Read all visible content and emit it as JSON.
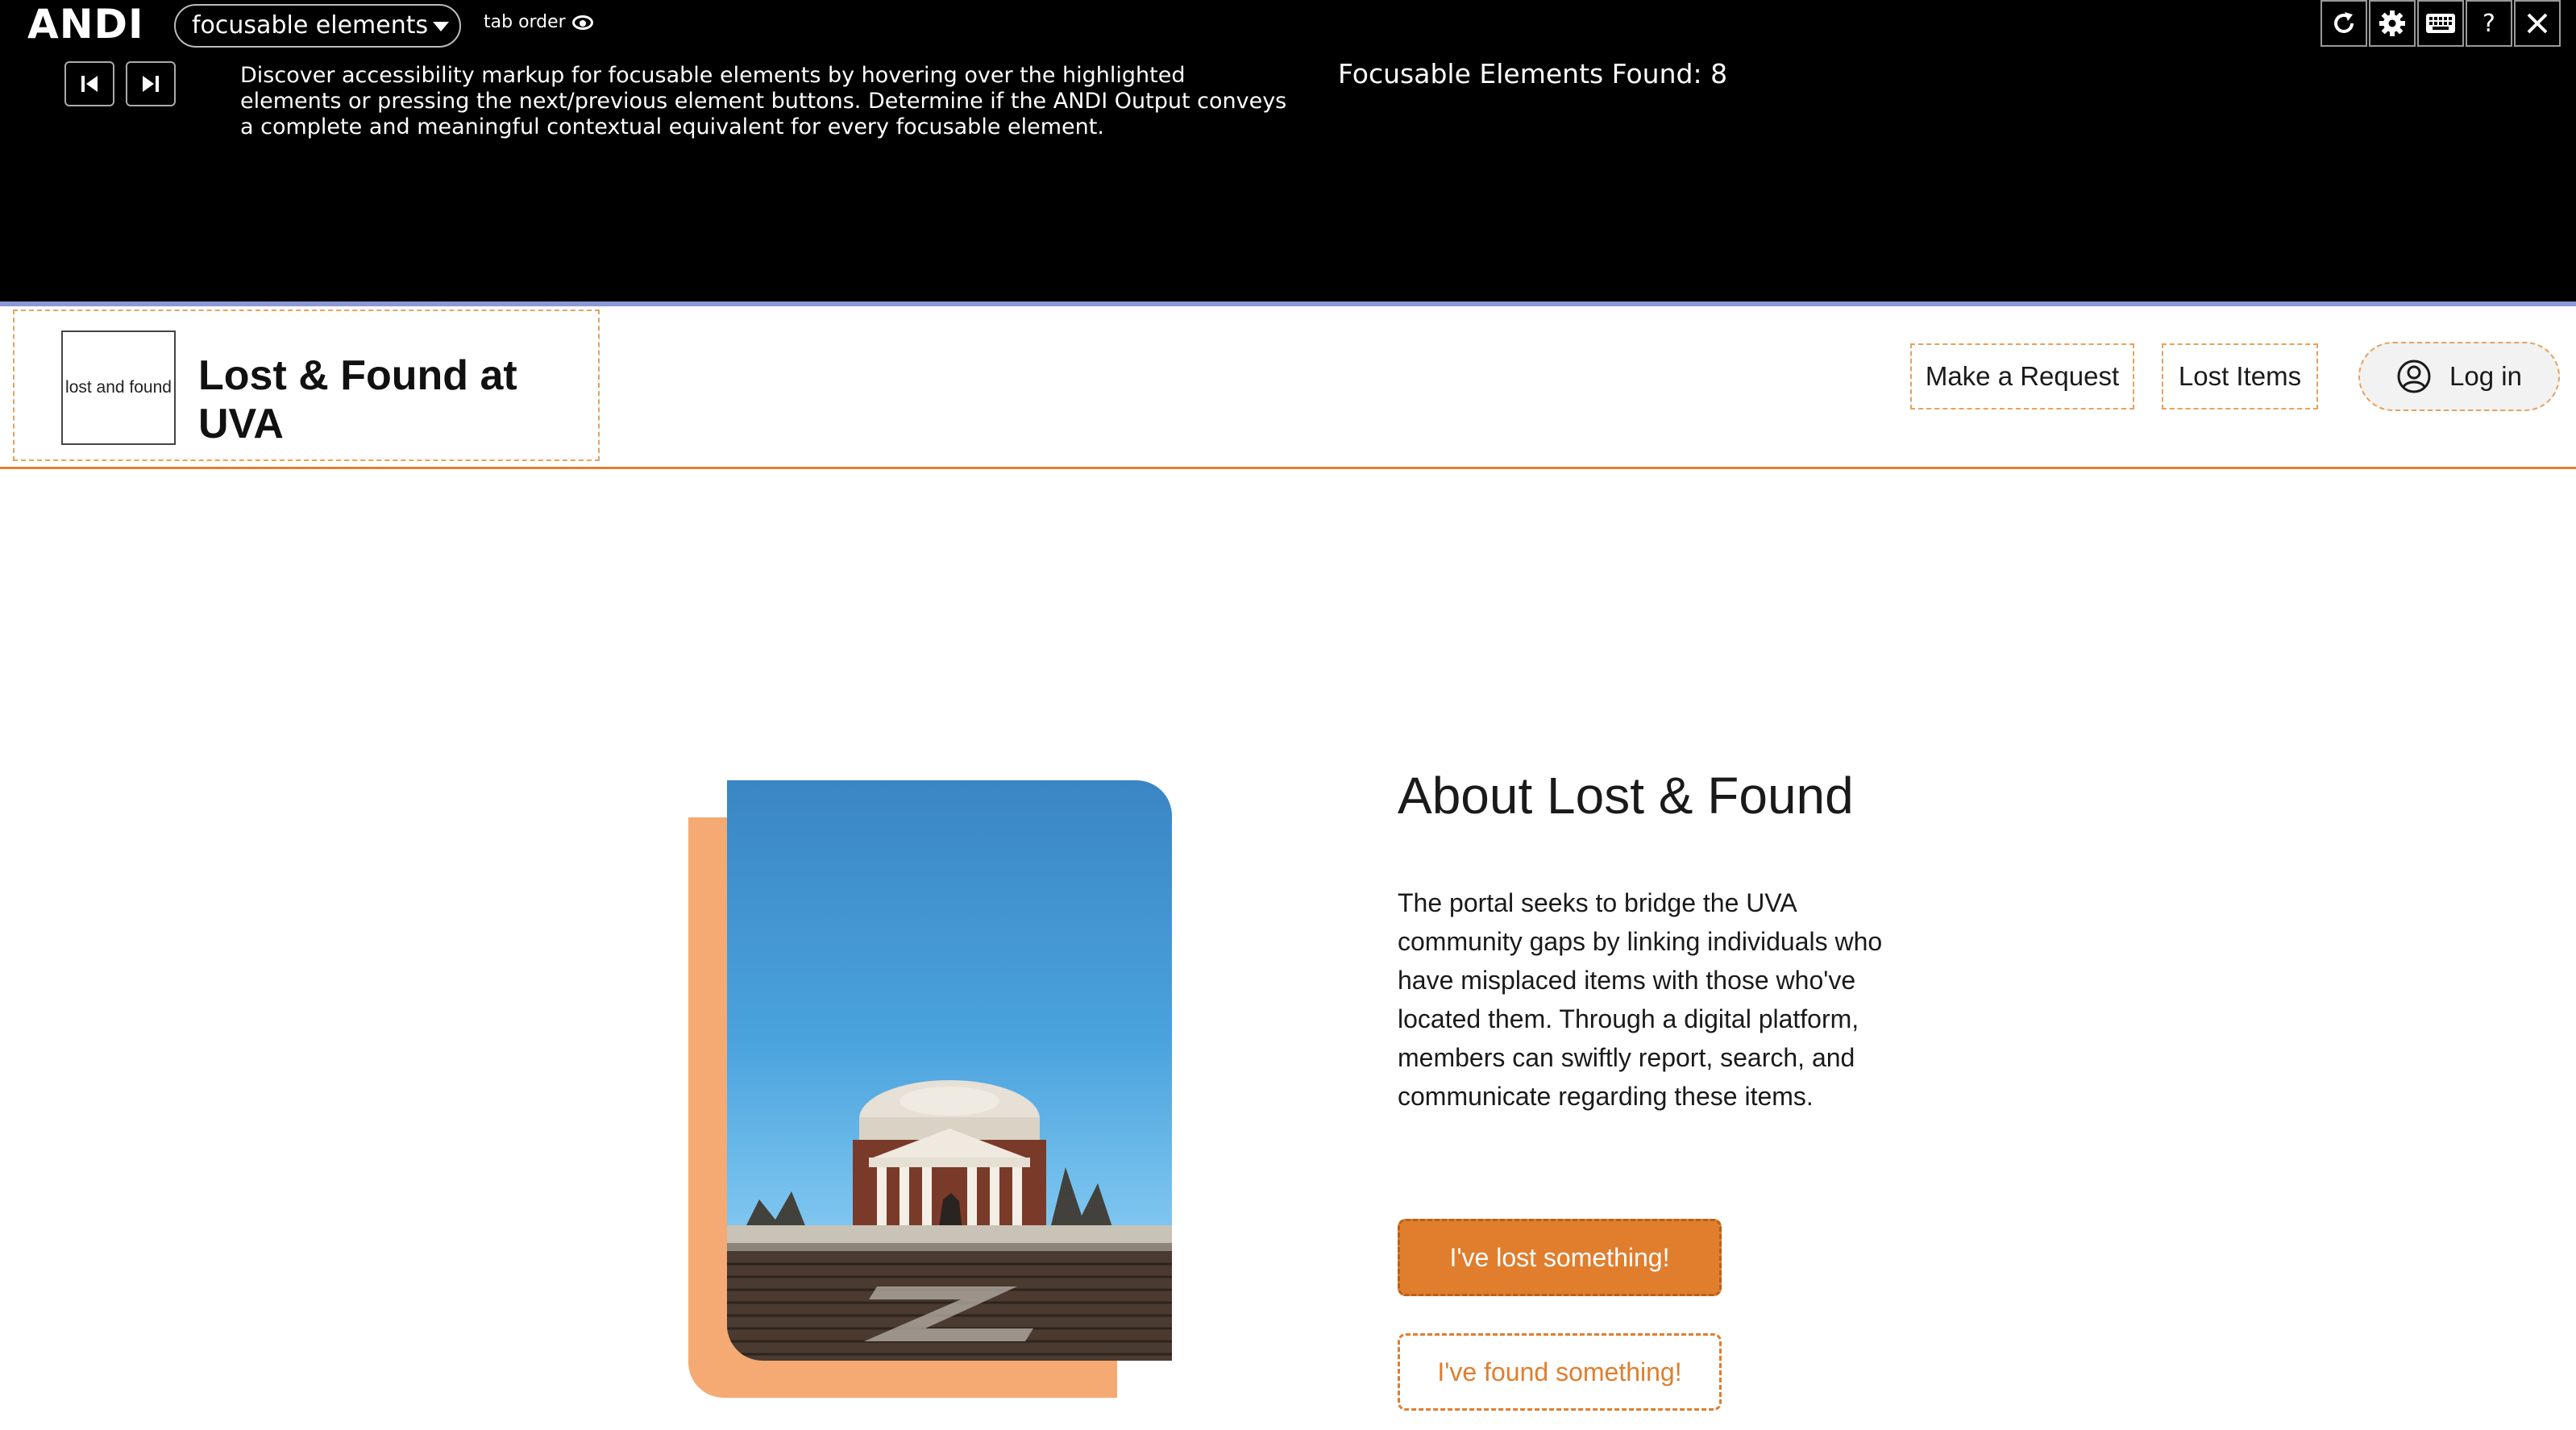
{
  "andi": {
    "logo": "ANDI",
    "module": "focusable elements",
    "tab_order_label": "tab order",
    "description": "Discover accessibility markup for focusable elements by hovering over the highlighted elements or pressing the next/previous element buttons. Determine if the ANDI Output conveys a complete and meaningful contextual equivalent for every focusable element.",
    "found_label": "Focusable Elements Found:",
    "found_count": "8",
    "tools": [
      "refresh-icon",
      "gear-icon",
      "keyboard-icon",
      "help-icon",
      "close-icon"
    ],
    "help_glyph": "?"
  },
  "header": {
    "logo_alt": "lost and found",
    "title": "Lost & Found at UVA",
    "nav": {
      "request": "Make a Request",
      "lost_items": "Lost Items",
      "login": "Log in"
    }
  },
  "about": {
    "title": "About Lost & Found",
    "body": "The portal seeks to bridge the UVA community gaps by linking individuals who have misplaced items with those who've located them. Through a digital platform, members can swiftly report, search, and communicate regarding these items.",
    "lost_button": "I've lost something!",
    "found_button": "I've found something!"
  },
  "colors": {
    "accent": "#e07e2e",
    "accent_light": "#f4aa72",
    "andi_bg": "#000000",
    "andi_divider": "#8c97d8"
  }
}
